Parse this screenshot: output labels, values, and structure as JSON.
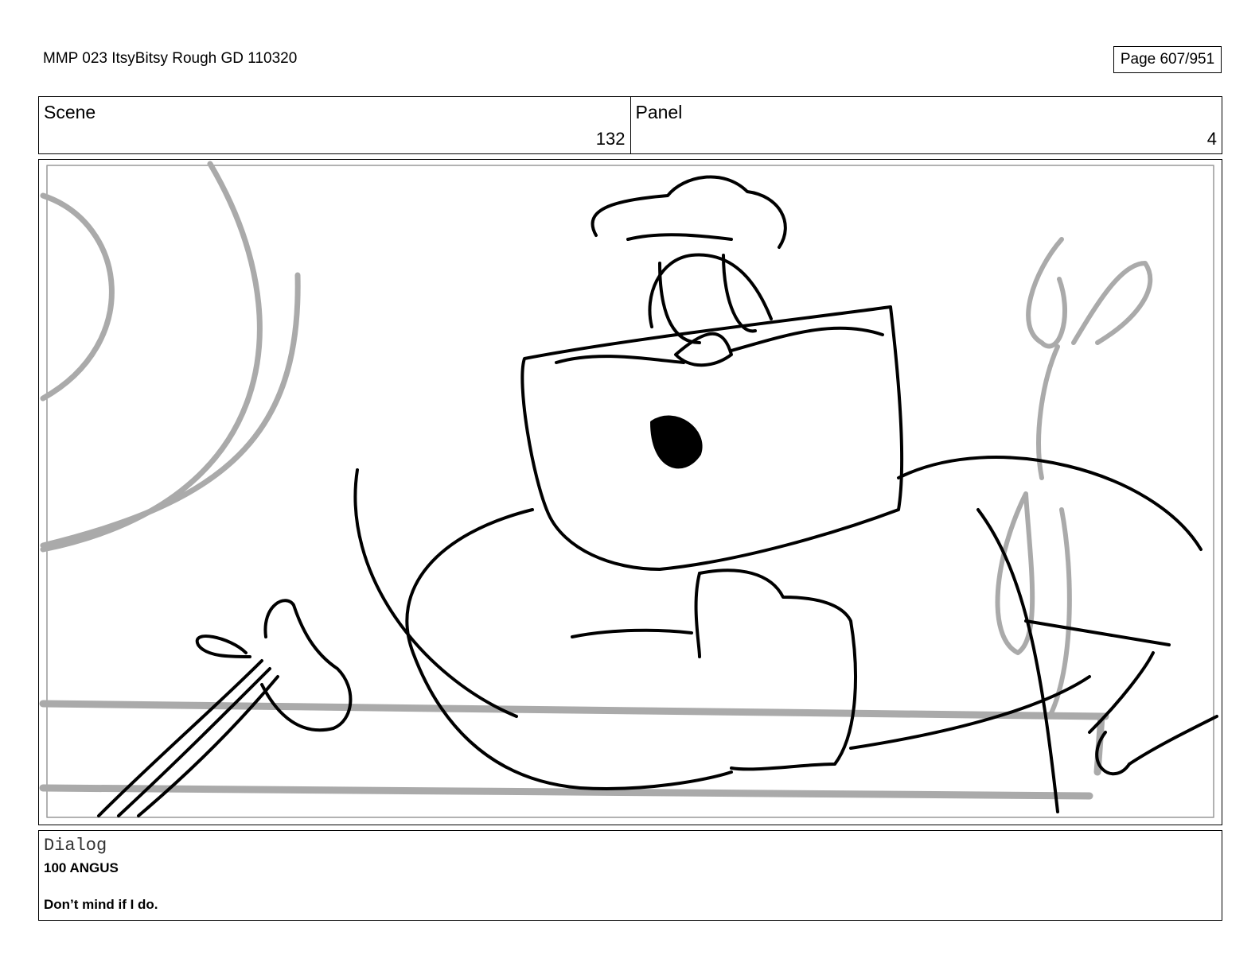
{
  "document": {
    "title": "MMP 023 ItsyBitsy Rough GD 110320",
    "page": "Page 607/951"
  },
  "header": {
    "scene_label": "Scene",
    "scene_value": "132",
    "panel_label": "Panel",
    "panel_value": "4"
  },
  "dialog": {
    "label": "Dialog",
    "speaker": "100 ANGUS",
    "line": "Don’t mind if I do."
  }
}
